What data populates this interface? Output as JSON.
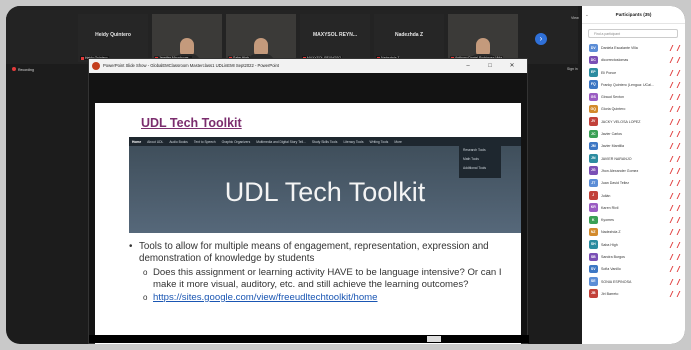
{
  "meeting": {
    "view_label": "View",
    "sign_in_label": "Sign in",
    "recording_label": "Recording",
    "tiles": [
      {
        "name": "Heidy Quintero",
        "tag": "Heidy Quintero",
        "video": false
      },
      {
        "name": "",
        "tag": "Jennifer Mauchowe...",
        "video": true
      },
      {
        "name": "",
        "tag": "Sabe High",
        "video": true
      },
      {
        "name": "MAXYSOL REYN...",
        "tag": "MAXYSOL REYNOSO",
        "video": false
      },
      {
        "name": "Nadezhda Z",
        "tag": "Nadezhda Z",
        "video": false
      },
      {
        "name": "",
        "tag": "Anthony Daniel Rodriguez Vida",
        "video": true
      }
    ]
  },
  "powerpoint": {
    "window_title": "PowerPoint Slide Show - GlobalEMClassroom Masterclass1 UDLinEMI Sept2022 - PowerPoint",
    "minimize": "–",
    "maximize": "□",
    "close": "✕"
  },
  "slide": {
    "title": "UDL Tech Toolkit",
    "nav": [
      "Home",
      "About UDL",
      "Audio Books",
      "Text to Speech",
      "Graphic Organizers",
      "Multimedia and Digital Story Tell...",
      "Study Skills Tools",
      "Literacy Tools",
      "Writing Tools",
      "More"
    ],
    "dropdown": [
      "Research Tools",
      "Math Tools",
      "Additional Tools"
    ],
    "banner_title": "UDL Tech Toolkit",
    "bullet": "Tools to allow for multiple means of engagement, representation, expression and demonstration of knowledge by students",
    "sub_question": "Does this assignment or learning activity HAVE to be language intensive? Or can I make it more visual, auditory, etc. and still achieve the learning outcomes?",
    "link": "https://sites.google.com/view/freeudltechtoolkit/home"
  },
  "participants": {
    "title": "Participants (35)",
    "search_placeholder": "Find a participant",
    "list": [
      {
        "initials": "DV",
        "name": "Daniela Escalante Villa",
        "color": "#5b8dd6"
      },
      {
        "initials": "DC",
        "name": "dicorrectoslomas",
        "color": "#7a4fb5"
      },
      {
        "initials": "EP",
        "name": "Eli Ponce",
        "color": "#2c8ca0"
      },
      {
        "initials": "FQ",
        "name": "Franky Quintero (Lengua: UCal...",
        "color": "#3d77c4"
      },
      {
        "initials": "GS",
        "name": "Giraud Sexton",
        "color": "#9a5cc2"
      },
      {
        "initials": "GQ",
        "name": "Gloria Quintero",
        "color": "#d38a2c"
      },
      {
        "initials": "JV",
        "name": "JACKY VELOSA LOPEZ",
        "color": "#c2413a"
      },
      {
        "initials": "JC",
        "name": "Javier Carlos",
        "color": "#3aa055"
      },
      {
        "initials": "JM",
        "name": "Javier Mantilla",
        "color": "#3d77c4"
      },
      {
        "initials": "JN",
        "name": "JAVIER NARANJO",
        "color": "#2c8ca0"
      },
      {
        "initials": "JG",
        "name": "Jhon Alexander Gomez",
        "color": "#7a4fb5"
      },
      {
        "initials": "JT",
        "name": "Juan David Tellez",
        "color": "#5b8dd6"
      },
      {
        "initials": "J",
        "name": "Julián",
        "color": "#c2413a"
      },
      {
        "initials": "KR",
        "name": "Karen Rivil",
        "color": "#9a5cc2"
      },
      {
        "initials": "K",
        "name": "Kyomes",
        "color": "#3aa055"
      },
      {
        "initials": "NZ",
        "name": "Nadezhda Z",
        "color": "#d38a2c"
      },
      {
        "initials": "SH",
        "name": "Saba High",
        "color": "#2c8ca0"
      },
      {
        "initials": "SB",
        "name": "Sandra Burgos",
        "color": "#7a4fb5"
      },
      {
        "initials": "SV",
        "name": "Sofia Vanillo",
        "color": "#3d77c4"
      },
      {
        "initials": "SE",
        "name": "SONIA ESPINOSA",
        "color": "#5b8dd6"
      },
      {
        "initials": "JB",
        "name": "Jiri Barreto",
        "color": "#c2413a"
      }
    ]
  }
}
